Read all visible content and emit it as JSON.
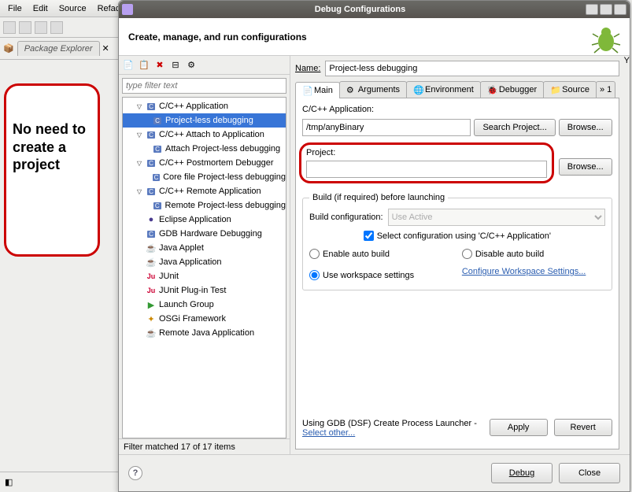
{
  "bg": {
    "menus": [
      "File",
      "Edit",
      "Source",
      "Refact"
    ],
    "view_tab": "Package Explorer"
  },
  "annotation": {
    "text": "No need to create a project"
  },
  "dialog": {
    "title": "Debug Configurations",
    "header": "Create, manage, and run configurations",
    "filter_placeholder": "type filter text",
    "tree": [
      {
        "label": "C/C++ Application",
        "level": 1,
        "exp": true,
        "icon": "c"
      },
      {
        "label": "Project-less debugging",
        "level": 2,
        "sel": true,
        "icon": "c"
      },
      {
        "label": "C/C++ Attach to Application",
        "level": 1,
        "exp": true,
        "icon": "c"
      },
      {
        "label": "Attach Project-less debugging",
        "level": 2,
        "icon": "c"
      },
      {
        "label": "C/C++ Postmortem Debugger",
        "level": 1,
        "exp": true,
        "icon": "c"
      },
      {
        "label": "Core file Project-less debugging",
        "level": 2,
        "icon": "c"
      },
      {
        "label": "C/C++ Remote Application",
        "level": 1,
        "exp": true,
        "icon": "c"
      },
      {
        "label": "Remote Project-less debugging",
        "level": 2,
        "icon": "c"
      },
      {
        "label": "Eclipse Application",
        "level": 1,
        "icon": "ecl"
      },
      {
        "label": "GDB Hardware Debugging",
        "level": 1,
        "icon": "c"
      },
      {
        "label": "Java Applet",
        "level": 1,
        "icon": "java"
      },
      {
        "label": "Java Application",
        "level": 1,
        "icon": "java"
      },
      {
        "label": "JUnit",
        "level": 1,
        "icon": "ju"
      },
      {
        "label": "JUnit Plug-in Test",
        "level": 1,
        "icon": "ju"
      },
      {
        "label": "Launch Group",
        "level": 1,
        "icon": "grp"
      },
      {
        "label": "OSGi Framework",
        "level": 1,
        "icon": "osgi"
      },
      {
        "label": "Remote Java Application",
        "level": 1,
        "icon": "java"
      }
    ],
    "filter_status": "Filter matched 17 of 17 items",
    "name_label": "Name:",
    "name_value": "Project-less debugging",
    "tabs": [
      "Main",
      "Arguments",
      "Environment",
      "Debugger",
      "Source"
    ],
    "main": {
      "app_label": "C/C++ Application:",
      "app_value": "/tmp/anyBinary",
      "search_project_btn": "Search Project...",
      "browse_btn": "Browse...",
      "project_label": "Project:",
      "project_value": "",
      "build_legend": "Build (if required) before launching",
      "build_config_label": "Build configuration:",
      "build_config_value": "Use Active",
      "select_config_chk": "Select configuration using 'C/C++ Application'",
      "enable_auto": "Enable auto build",
      "disable_auto": "Disable auto build",
      "use_workspace": "Use workspace settings",
      "config_ws_link": "Configure Workspace Settings..."
    },
    "launcher_prefix": "Using GDB (DSF) Create Process Launcher - ",
    "launcher_link": "Select other...",
    "apply_btn": "Apply",
    "revert_btn": "Revert",
    "debug_btn": "Debug",
    "close_btn": "Close"
  }
}
